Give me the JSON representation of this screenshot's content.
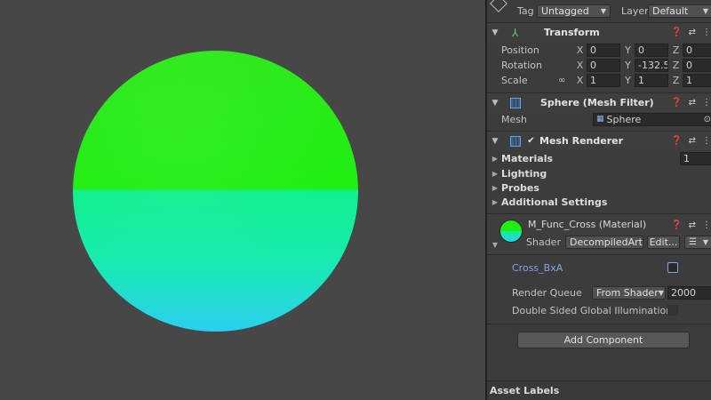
{
  "top": {
    "tag_label": "Tag",
    "tag_value": "Untagged",
    "layer_label": "Layer",
    "layer_value": "Default"
  },
  "transform": {
    "title": "Transform",
    "position_label": "Position",
    "rotation_label": "Rotation",
    "scale_label": "Scale",
    "position": {
      "x": "0",
      "y": "0",
      "z": "0"
    },
    "rotation": {
      "x": "0",
      "y": "-132.5",
      "z": "0"
    },
    "scale": {
      "x": "1",
      "y": "1",
      "z": "1"
    },
    "axis_x": "X",
    "axis_y": "Y",
    "axis_z": "Z"
  },
  "mesh_filter": {
    "title": "Sphere (Mesh Filter)",
    "mesh_label": "Mesh",
    "mesh_value": "Sphere"
  },
  "mesh_renderer": {
    "title": "Mesh Renderer",
    "materials_label": "Materials",
    "materials_count": "1",
    "lighting_label": "Lighting",
    "probes_label": "Probes",
    "additional_label": "Additional Settings"
  },
  "material": {
    "title": "M_Func_Cross (Material)",
    "shader_label": "Shader",
    "shader_value": "DecompiledArt",
    "edit_label": "Edit...",
    "property_label": "Cross_BxA",
    "render_queue_label": "Render Queue",
    "render_queue_mode": "From Shader",
    "render_queue_value": "2000",
    "double_sided_label": "Double Sided Global Illumination"
  },
  "add_component_label": "Add Component",
  "asset_labels_label": "Asset Labels",
  "colors": {
    "sphere_top": "#20ee12",
    "sphere_bottom": "#2bcff0",
    "link_blue": "#7fa6e6",
    "inspector_bg": "#3c3c3c",
    "scene_bg": "#474747"
  }
}
